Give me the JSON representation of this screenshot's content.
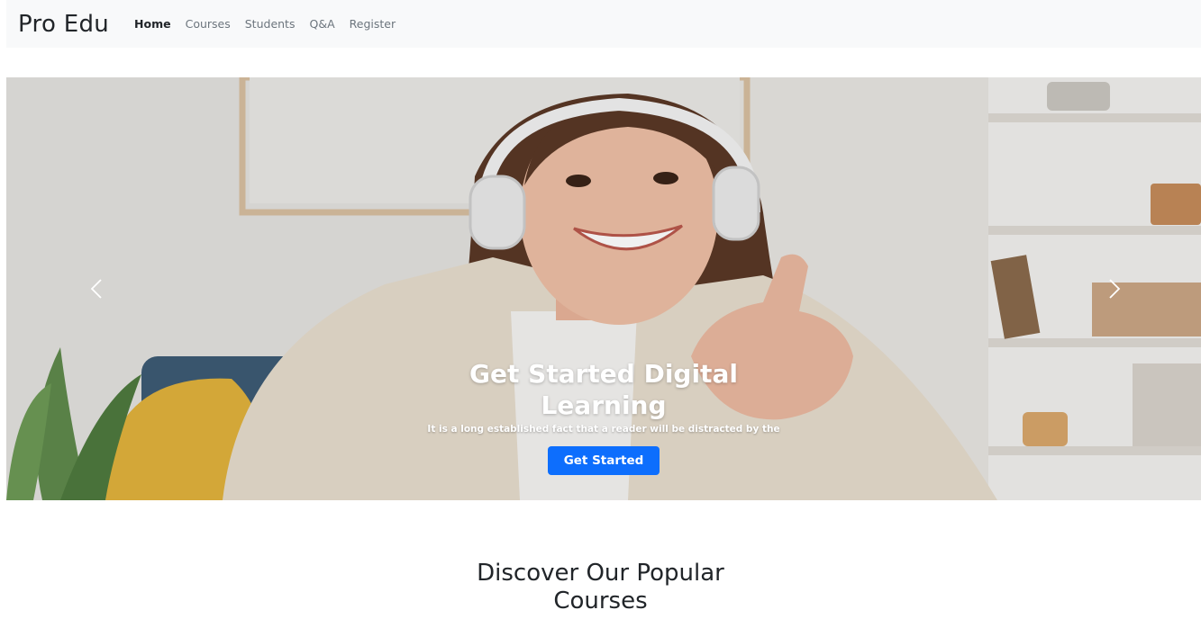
{
  "navbar": {
    "brand": "Pro Edu",
    "links": [
      {
        "label": "Home",
        "active": true
      },
      {
        "label": "Courses",
        "active": false
      },
      {
        "label": "Students",
        "active": false
      },
      {
        "label": "Q&A",
        "active": false
      },
      {
        "label": "Register",
        "active": false
      }
    ]
  },
  "hero": {
    "title": "Get Started Digital Learning",
    "text": "It is a long established fact that a reader will be distracted by the",
    "button_label": "Get Started",
    "prev_icon": "chevron-left-icon",
    "next_icon": "chevron-right-icon",
    "image_subject": "smiling student with headphones giving thumbs up",
    "button_color": "#0d6efd"
  },
  "section": {
    "title_line1": "Discover Our Popular",
    "title_line2": "Courses"
  }
}
